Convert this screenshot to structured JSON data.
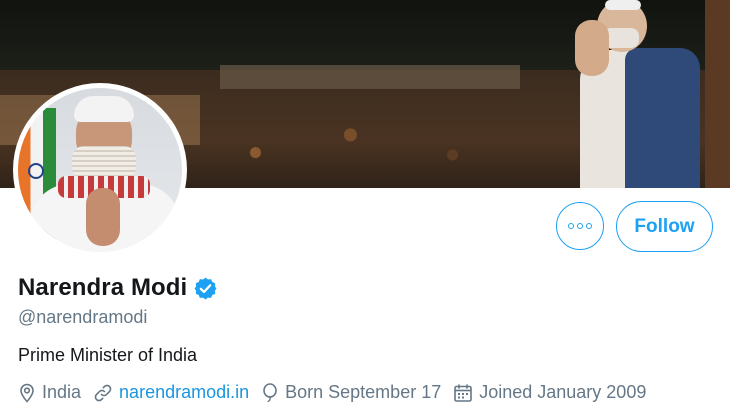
{
  "profile": {
    "display_name": "Narendra Modi",
    "handle": "@narendramodi",
    "bio": "Prime Minister of India",
    "verified": true,
    "location": "India",
    "website": "narendramodi.in",
    "born": "Born September 17",
    "joined": "Joined January 2009"
  },
  "actions": {
    "follow_label": "Follow",
    "more_icon": "more-dots-icon"
  },
  "icons": {
    "location": "location-pin-icon",
    "website": "link-icon",
    "born": "balloon-icon",
    "joined": "calendar-icon",
    "verified": "verified-badge-icon"
  },
  "colors": {
    "accent": "#1da1f2",
    "link": "#1b95e0",
    "secondary_text": "#657786",
    "primary_text": "#14171a"
  }
}
